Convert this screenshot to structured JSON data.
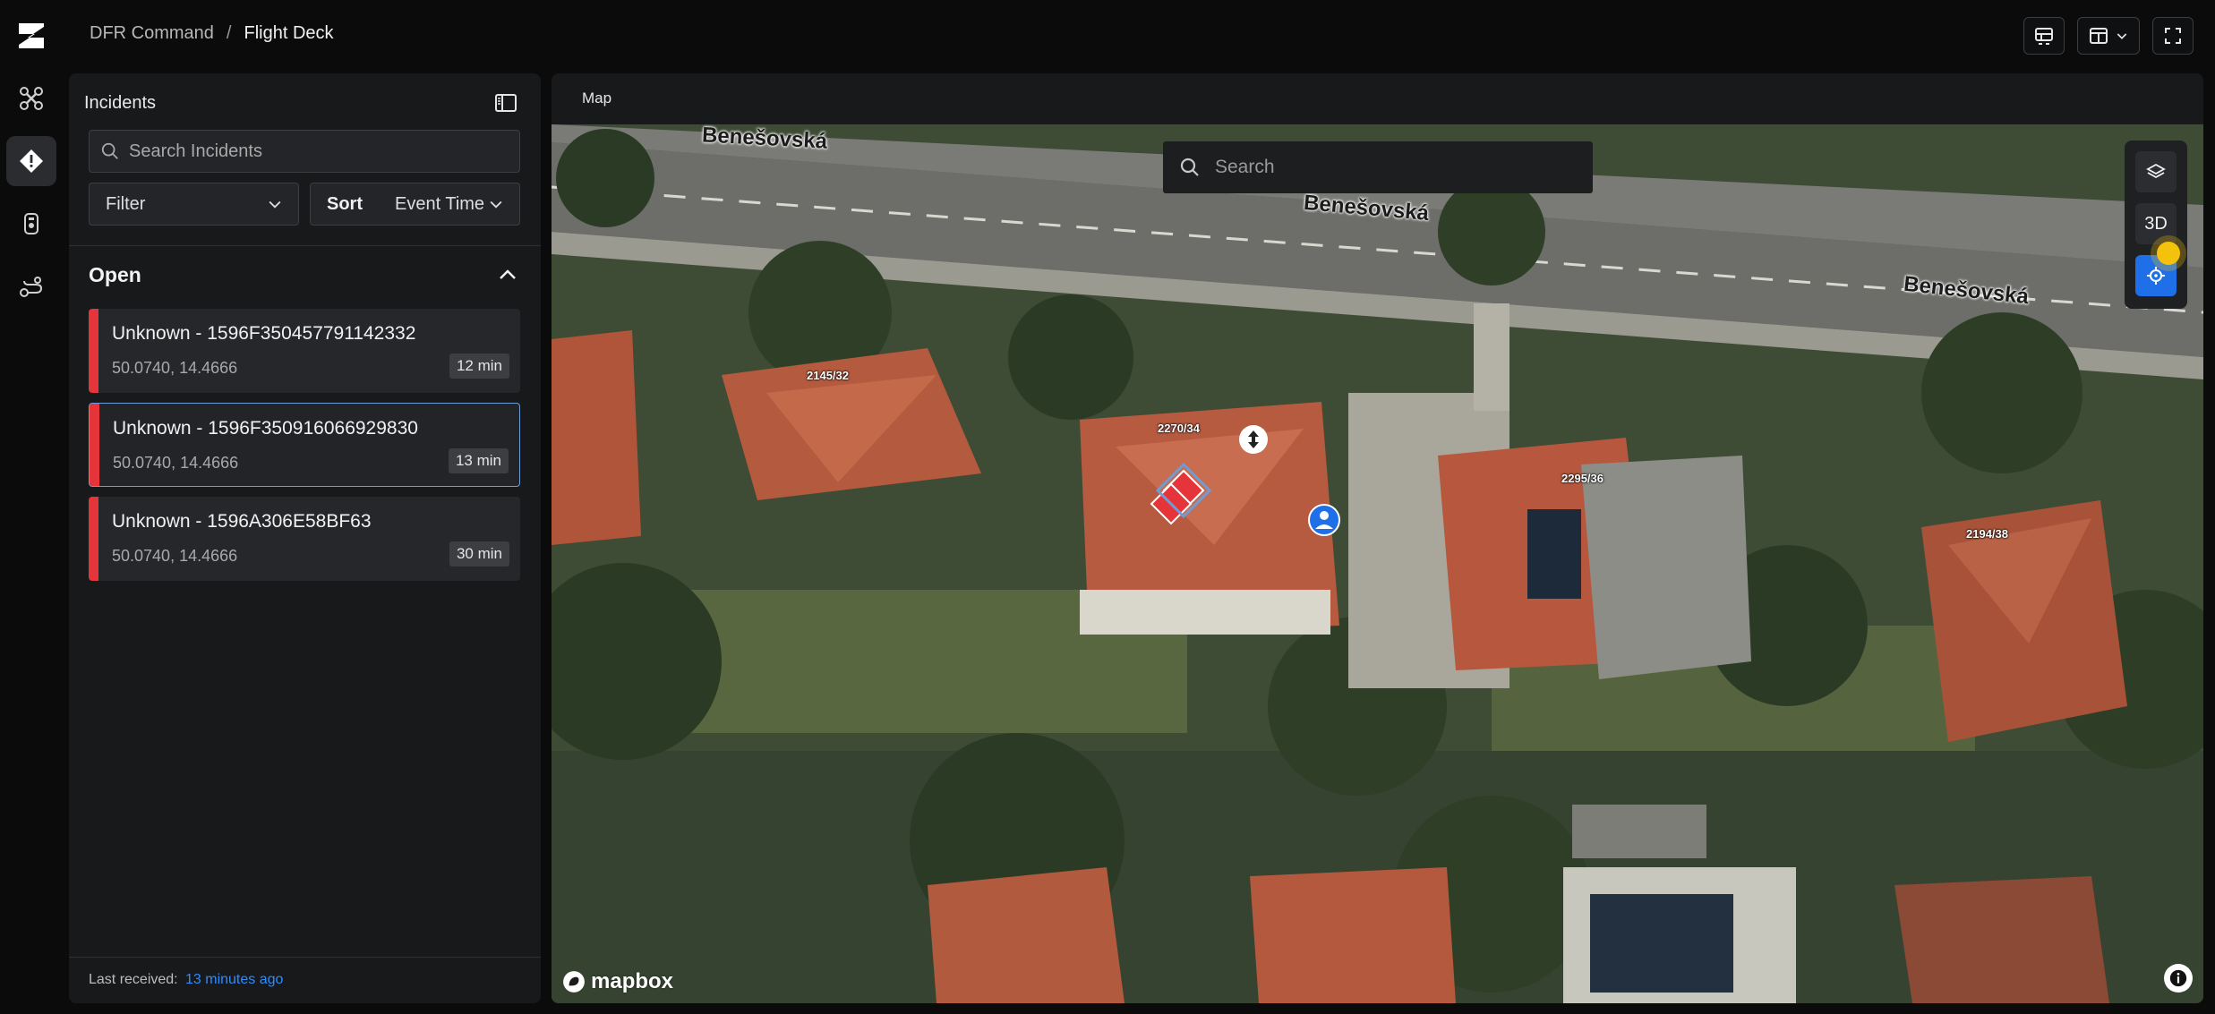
{
  "app": {
    "breadcrumb": [
      "DFR Command",
      "Flight Deck"
    ],
    "separator": "/"
  },
  "rail": {
    "icons": [
      "brand-logo-icon",
      "drone-icon",
      "incident-icon",
      "radio-icon",
      "route-icon"
    ],
    "active": "incident-icon"
  },
  "topbar": {
    "icons": [
      "dashboard-layout-icon",
      "split-view-icon",
      "chevron-down-icon",
      "fullscreen-icon"
    ]
  },
  "incidents": {
    "title": "Incidents",
    "search_placeholder": "Search Incidents",
    "filter_label": "Filter",
    "sort_label": "Sort",
    "sort_value": "Event Time",
    "section_title": "Open",
    "items": [
      {
        "title": "Unknown - 1596F350457791142332",
        "coords": "50.0740, 14.4666",
        "age": "12 min"
      },
      {
        "title": "Unknown - 1596F350916066929830",
        "coords": "50.0740, 14.4666",
        "age": "13 min",
        "selected": true
      },
      {
        "title": "Unknown - 1596A306E58BF63",
        "coords": "50.0740, 14.4666",
        "age": "30 min"
      }
    ],
    "footer": {
      "label": "Last received:",
      "value": "13 minutes ago"
    }
  },
  "map": {
    "tab": "Map",
    "search_placeholder": "Search",
    "btn_3d": "3D",
    "streets": [
      "Benešovská",
      "Benešovská",
      "Benešovská"
    ],
    "parcels": [
      "2145/32",
      "2270/34",
      "2295/36",
      "2194/38"
    ],
    "logo": "mapbox",
    "colors": {
      "accent": "#1e6fe8",
      "alert": "#e5353a",
      "cursor": "#f4c20d",
      "link": "#2f8bff"
    }
  }
}
